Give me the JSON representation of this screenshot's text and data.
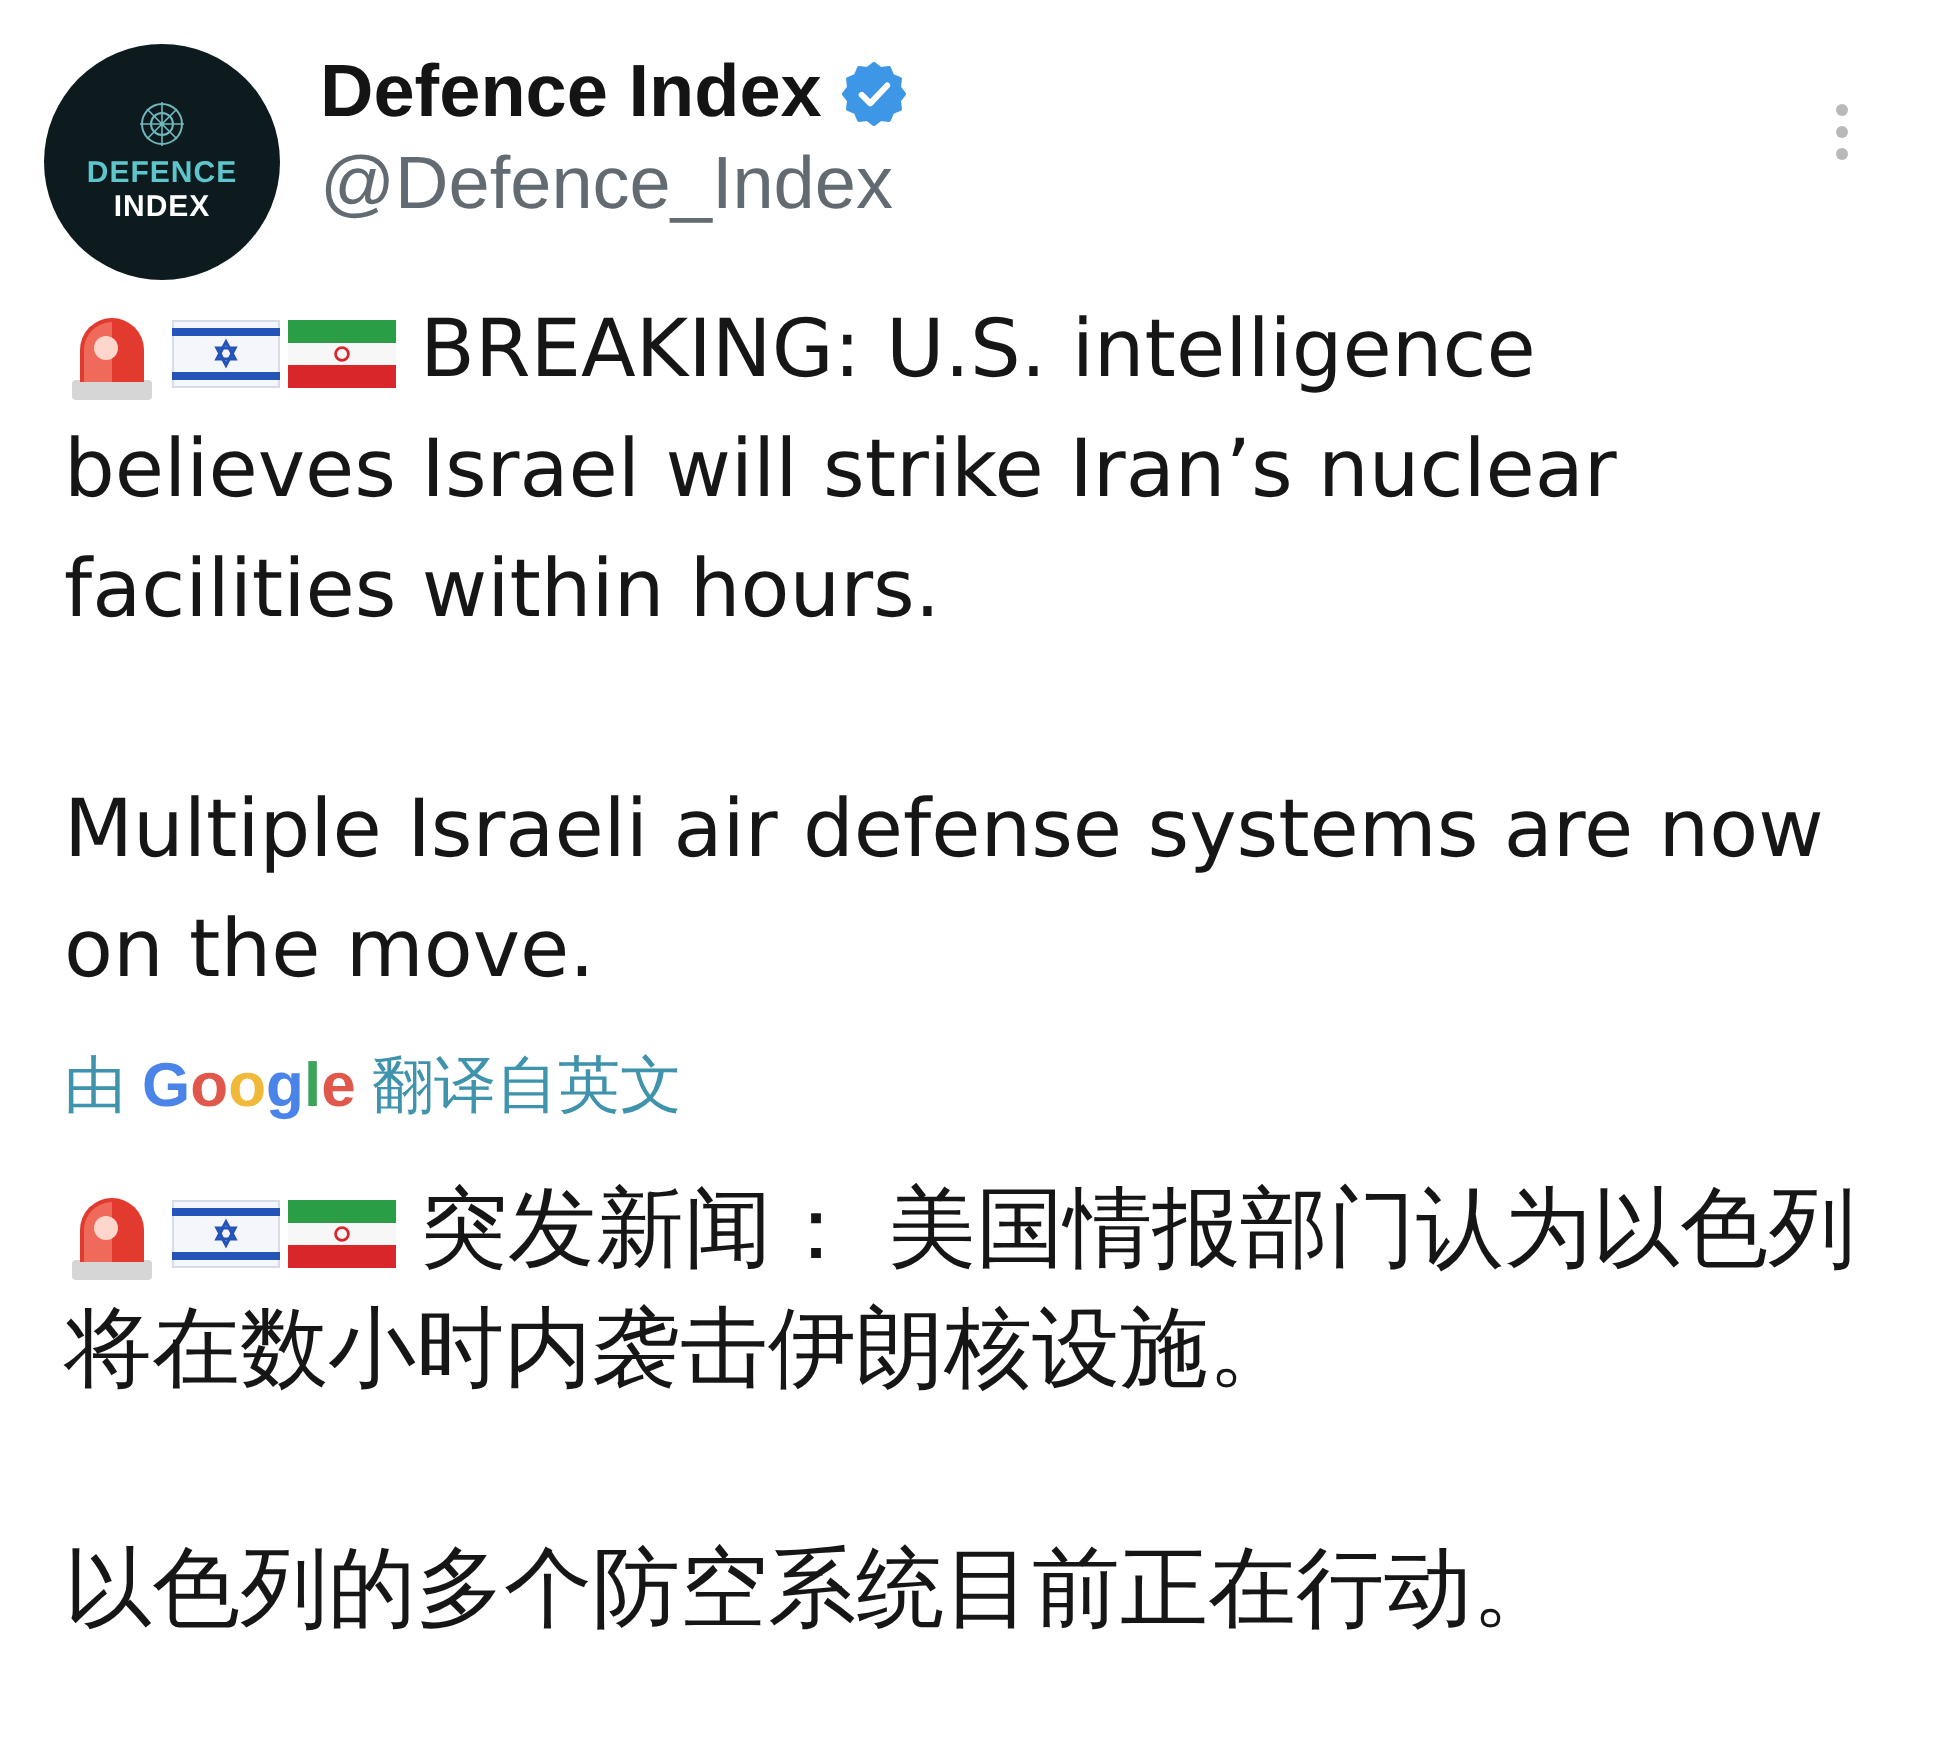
{
  "author": {
    "avatar": {
      "line_1": "DEFENCE",
      "line_2": "INDEX"
    },
    "name": "Defence Index",
    "verified": true,
    "handle": "@Defence_Index"
  },
  "post": {
    "paragraphs": [
      {
        "alert_icons": true,
        "text": "BREAKING: U.S. intelligence believes Israel will strike Iran’s nuclear facilities within hours."
      },
      {
        "alert_icons": false,
        "text": "Multiple Israeli air defense systems are now on the move."
      }
    ]
  },
  "translation": {
    "before": "由",
    "provider": "Google",
    "after": "翻译自英文"
  },
  "translated": {
    "paragraphs": [
      {
        "alert_icons": true,
        "text": "突发新闻： 美国情报部门认为以色列将在数小时内袭击伊朗核设施。"
      },
      {
        "alert_icons": false,
        "text": "以色列的多个防空系统目前正在行动。"
      }
    ]
  }
}
